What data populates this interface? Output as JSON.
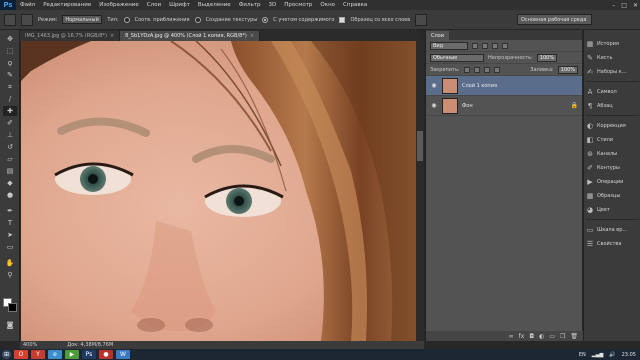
{
  "app": {
    "logo": "Ps",
    "menu": [
      "Файл",
      "Редактирование",
      "Изображение",
      "Слои",
      "Шрифт",
      "Выделение",
      "Фильтр",
      "3D",
      "Просмотр",
      "Окно",
      "Справка"
    ],
    "window_controls": [
      "–",
      "□",
      "✕"
    ]
  },
  "options_bar": {
    "mode_label": "Режим:",
    "mode_value": "Нормальный",
    "type_label": "Тип:",
    "type_options": [
      "Соотв. приближения",
      "Создание текстуры",
      "С учетом содержимого"
    ],
    "type_selected_index": 2,
    "sample_all_label": "Образец со всех слоев",
    "sample_all_checked": true,
    "workspace": "Основная рабочая среда"
  },
  "tabs": [
    {
      "label": "IMG_1463.jpg @ 16,7% (RGB/8*)",
      "active": false
    },
    {
      "label": "8_Sb1YDzA.jpg @ 400% (Слой 1 копия, RGB/8*)",
      "active": true
    }
  ],
  "tools": [
    "move",
    "marquee",
    "lasso",
    "quick-select",
    "crop",
    "eyedropper",
    "spot-heal",
    "brush",
    "clone-stamp",
    "history-brush",
    "eraser",
    "gradient",
    "blur",
    "dodge",
    "pen",
    "type",
    "path-select",
    "shape",
    "hand",
    "zoom"
  ],
  "status": {
    "zoom": "400%",
    "doc_size": "Док: 4,38М/8,76М"
  },
  "layers_panel": {
    "tab": "Слои",
    "filter": "Вид",
    "blend_mode": "Обычные",
    "opacity_label": "Непрозрачность:",
    "opacity_value": "100%",
    "lock_label": "Закрепить:",
    "fill_label": "Заливка:",
    "fill_value": "100%",
    "layers": [
      {
        "name": "Слой 1 копия",
        "selected": true,
        "locked": false
      },
      {
        "name": "Фон",
        "selected": false,
        "locked": true
      }
    ]
  },
  "dock": {
    "groups": [
      [
        "История",
        "Кисть",
        "Наборы к..."
      ],
      [
        "Символ",
        "Абзац"
      ],
      [
        "Коррекция",
        "Стили",
        "Каналы",
        "Контуры",
        "Операции",
        "Образцы",
        "Цвет"
      ],
      [
        "Шкала вр...",
        "Свойства"
      ]
    ]
  },
  "taskbar": {
    "lang": "EN",
    "time": "23:05"
  }
}
